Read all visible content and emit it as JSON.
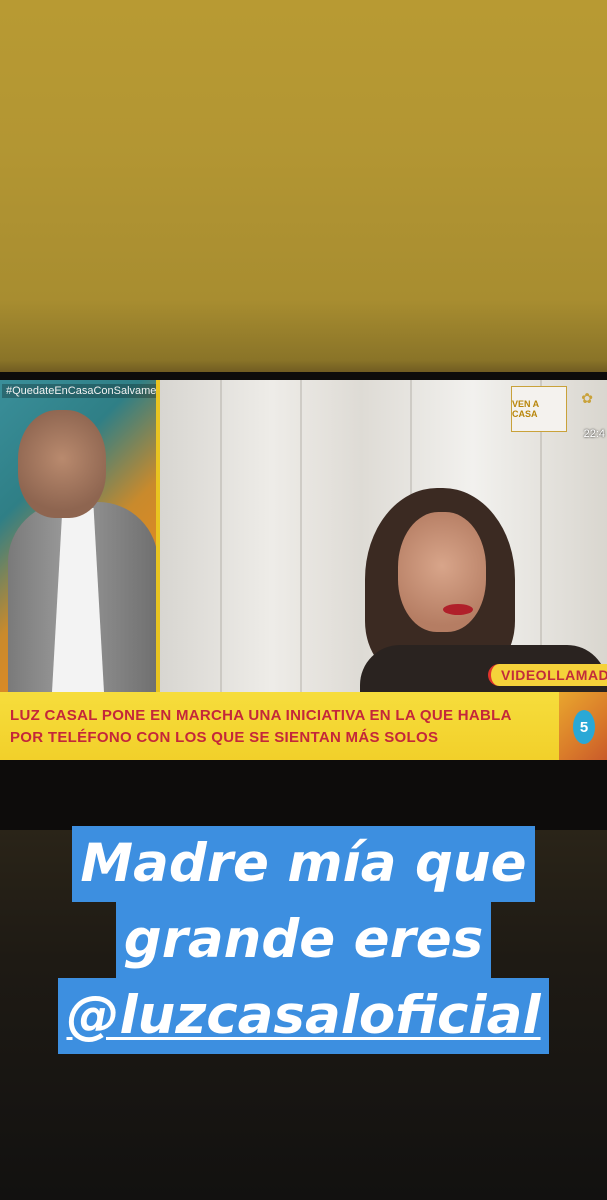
{
  "tv_broadcast": {
    "host_tag": "#QuedateEnCasaConSalvame",
    "corner_logo": "VEN A CASA",
    "clock": "22:4",
    "lower_third_label": "VIDEOLLAMADA",
    "ticker_lines": [
      "LUZ CASAL PONE EN MARCHA UNA INICIATIVA EN LA QUE HABLA",
      "POR TELÉFONO CON LOS QUE SE SIENTAN MÁS SOLOS"
    ],
    "channel_logo": "5"
  },
  "story_caption": {
    "line1": "Madre mía que",
    "line2": "grande eres",
    "mention": "@luzcasaloficial",
    "highlight_color": "#3d8fe0",
    "text_color": "#ffffff"
  },
  "colors": {
    "ticker_yellow": "#f2d02a",
    "ticker_red": "#c4273a"
  }
}
